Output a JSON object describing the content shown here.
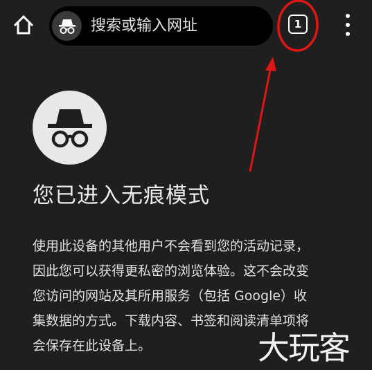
{
  "toolbar": {
    "home_icon": "home-icon",
    "omnibox": {
      "placeholder": "搜索或输入网址",
      "incognito_icon": "incognito-icon"
    },
    "tab_count": "1",
    "menu_icon": "more-vert-icon"
  },
  "main": {
    "hero_icon": "incognito-icon",
    "heading": "您已进入无痕模式",
    "description_lines": [
      "使用此设备的其他用户不会看到您的活动记录，",
      "因此您可以获得更私密的浏览体验。这不会改变",
      "您访问的网站及其所用服务（包括 Google）收",
      "集数据的方式。下载内容、书签和阅读清单项将",
      "会保存在此设备上。"
    ]
  },
  "watermark": {
    "text": "大玩客"
  },
  "colors": {
    "background": "#1f1f1f",
    "omnibox": "#000000",
    "annotation": "#e01616",
    "text": "#e0e0e0"
  }
}
